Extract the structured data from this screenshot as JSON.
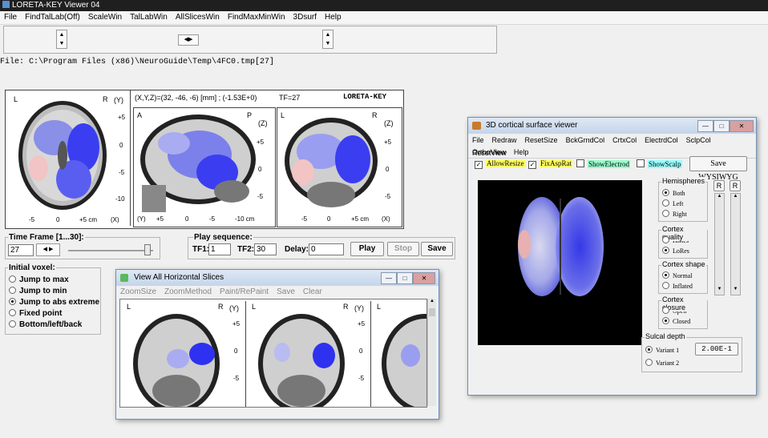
{
  "main_window": {
    "title": "LORETA-KEY Viewer 04",
    "menu": [
      "File",
      "FindTalLab(Off)",
      "ScaleWin",
      "TalLabWin",
      "AllSlicesWin",
      "FindMaxMinWin",
      "3Dsurf",
      "Help"
    ],
    "file_path": "File: C:\\Program Files (x86)\\NeuroGuide\\Temp\\4FC0.tmp[27]"
  },
  "slice_viewer": {
    "coords": "(X,Y,Z)=(32, -46, -6) [mm] ; (-1.53E+0)",
    "tf": "TF=27",
    "brand": "LORETA-KEY",
    "axial": {
      "left": "L",
      "right": "R",
      "axis": "(Y)",
      "yticks": [
        "+5",
        "0",
        "-5",
        "-10"
      ],
      "xticks": [
        "-5",
        "0",
        "+5 cm"
      ],
      "xaxis": "(X)"
    },
    "sagittal": {
      "left": "A",
      "right": "P",
      "axis": "(Z)",
      "yticks": [
        "+5",
        "0",
        "-5"
      ],
      "xaxis": "(Y)",
      "xticks": [
        "+5",
        "0",
        "-5",
        "-10 cm"
      ]
    },
    "coronal": {
      "left": "L",
      "right": "R",
      "axis": "(Z)",
      "yticks": [
        "+5",
        "0",
        "-5"
      ],
      "xticks": [
        "-5",
        "0",
        "+5 cm"
      ],
      "xaxis": "(X)"
    }
  },
  "controls": {
    "time_frame_label": "Time Frame [1...30]:",
    "time_frame_value": "27",
    "play_label": "Play sequence:",
    "tf1_label": "TF1:",
    "tf1_value": "1",
    "tf2_label": "TF2:",
    "tf2_value": "30",
    "delay_label": "Delay:",
    "delay_value": "0",
    "play": "Play",
    "stop": "Stop",
    "save": "Save",
    "initial_voxel_label": "Initial voxel:",
    "voxel_options": [
      "Jump to max",
      "Jump to min",
      "Jump to abs extreme",
      "Fixed point",
      "Bottom/left/back"
    ],
    "voxel_selected": 2
  },
  "horizontal_window": {
    "title": "View All Horizontal Slices",
    "menu": [
      "ZoomSize",
      "ZoomMethod",
      "Paint/RePaint",
      "Save",
      "Clear"
    ],
    "slice1": {
      "left": "L",
      "right": "R",
      "axis": "(Y)",
      "ticks": [
        "+5",
        "0",
        "-5"
      ]
    },
    "slice2": {
      "left": "L",
      "right": "R",
      "axis": "(Y)",
      "ticks": [
        "+5",
        "0",
        "-5"
      ]
    },
    "slice3": {
      "left": "L"
    }
  },
  "cortical_window": {
    "title": "3D cortical surface viewer",
    "menu_row1": [
      "File",
      "Redraw",
      "ResetSize",
      "BckGrndCol",
      "CrtxCol",
      "ElectrdCol",
      "SclpCol",
      "ResetView"
    ],
    "menu_row2": [
      "OrthoView",
      "Help"
    ],
    "checks": [
      {
        "label": "AllowResize",
        "checked": true,
        "color": "#ffff66"
      },
      {
        "label": "FixAspRat",
        "checked": true,
        "color": "#ffff66"
      },
      {
        "label": "ShowElectrod",
        "checked": false,
        "color": "#99ffcc"
      },
      {
        "label": "ShowScalp",
        "checked": false,
        "color": "#99ffff"
      }
    ],
    "save_button": "Save WYSIWYG",
    "hemispheres": {
      "title": "Hemispheres",
      "options": [
        "Both",
        "Left",
        "Right"
      ],
      "selected": 0
    },
    "quality": {
      "title": "Cortex quality",
      "options": [
        "HiRes",
        "LoRes"
      ],
      "selected": 1
    },
    "shape": {
      "title": "Cortex shape",
      "options": [
        "Normal",
        "Inflated"
      ],
      "selected": 0
    },
    "closure": {
      "title": "Cortex closure",
      "options": [
        "Open",
        "Closed"
      ],
      "selected": 1
    },
    "sulcal": {
      "title": "Sulcal depth",
      "options": [
        "Variant 1",
        "Variant 2"
      ],
      "selected": 0,
      "value": "2.00E-1"
    },
    "r_label_1": "R",
    "r_label_2": "R"
  }
}
